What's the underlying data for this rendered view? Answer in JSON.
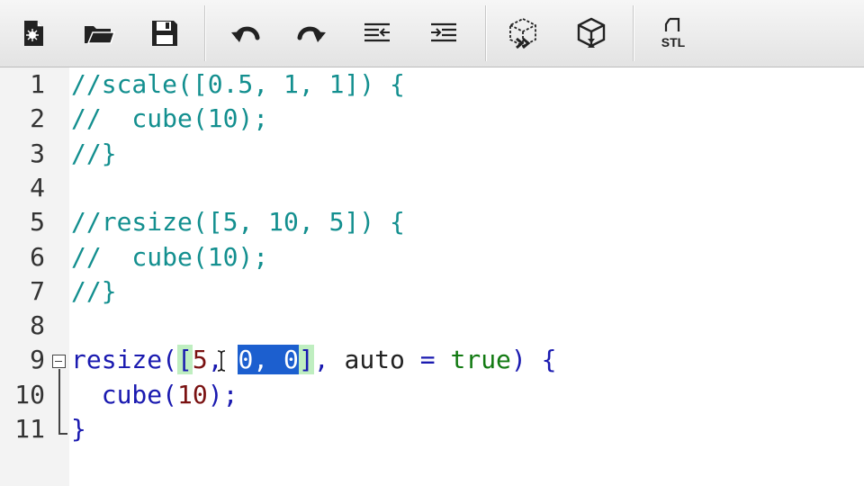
{
  "toolbar": {
    "buttons": [
      {
        "name": "new-file-button",
        "icon": "new-file-icon"
      },
      {
        "name": "open-file-button",
        "icon": "folder-open-icon"
      },
      {
        "name": "save-button",
        "icon": "floppy-disk-icon"
      },
      {
        "name": "undo-button",
        "icon": "undo-icon"
      },
      {
        "name": "redo-button",
        "icon": "redo-icon"
      },
      {
        "name": "unindent-button",
        "icon": "outdent-icon"
      },
      {
        "name": "indent-button",
        "icon": "indent-icon"
      },
      {
        "name": "preview-button",
        "icon": "preview-cube-icon"
      },
      {
        "name": "render-button",
        "icon": "render-cube-icon"
      },
      {
        "name": "export-stl-button",
        "icon": "stl-export-icon",
        "label": "STL"
      }
    ]
  },
  "editor": {
    "lines": [
      {
        "num": "1",
        "tokens": [
          {
            "t": "//scale([0.5, 1, 1]) {",
            "c": "comment"
          }
        ]
      },
      {
        "num": "2",
        "tokens": [
          {
            "t": "//  cube(10);",
            "c": "comment"
          }
        ]
      },
      {
        "num": "3",
        "tokens": [
          {
            "t": "//}",
            "c": "comment"
          }
        ]
      },
      {
        "num": "4",
        "tokens": []
      },
      {
        "num": "5",
        "tokens": [
          {
            "t": "//resize([5, 10, 5]) {",
            "c": "comment"
          }
        ]
      },
      {
        "num": "6",
        "tokens": [
          {
            "t": "//  cube(10);",
            "c": "comment"
          }
        ]
      },
      {
        "num": "7",
        "tokens": [
          {
            "t": "//}",
            "c": "comment"
          }
        ]
      },
      {
        "num": "8",
        "tokens": []
      },
      {
        "num": "9",
        "tokens": [
          {
            "t": "resize",
            "c": "kw"
          },
          {
            "t": "(",
            "c": "punct"
          },
          {
            "t": "[",
            "c": "punct brk"
          },
          {
            "t": "5",
            "c": "num"
          },
          {
            "t": ", ",
            "c": "punct"
          },
          {
            "t": "0, 0",
            "c": "sel"
          },
          {
            "t": "]",
            "c": "punct brk"
          },
          {
            "t": ", ",
            "c": "punct"
          },
          {
            "t": "auto",
            "c": "text"
          },
          {
            "t": " = ",
            "c": "punct"
          },
          {
            "t": "true",
            "c": "bool"
          },
          {
            "t": ") {",
            "c": "punct"
          }
        ]
      },
      {
        "num": "10",
        "tokens": [
          {
            "t": "  cube",
            "c": "kw"
          },
          {
            "t": "(",
            "c": "punct"
          },
          {
            "t": "10",
            "c": "num"
          },
          {
            "t": ");",
            "c": "punct"
          }
        ]
      },
      {
        "num": "11",
        "tokens": [
          {
            "t": "}",
            "c": "punct"
          }
        ]
      }
    ]
  },
  "colors": {
    "comment": "#138f8f",
    "keyword": "#1a1ab0",
    "number": "#7a1212",
    "boolean": "#127a12",
    "selection": "#1c5fcf",
    "bracket_match": "#bfeec0"
  }
}
